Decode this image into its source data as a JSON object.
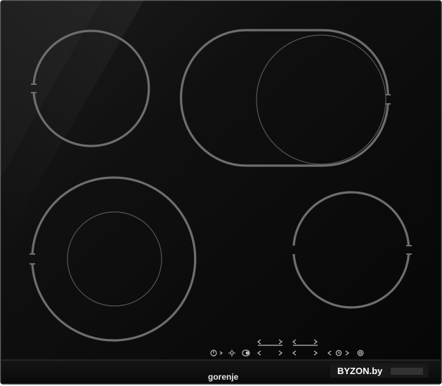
{
  "product": {
    "brand": "gorenje",
    "watermark": "BYZON.by"
  },
  "controls": {
    "lower_row": [
      "power-lock-icon",
      "chevron-right-icon",
      "sun-icon",
      "toggle-icon",
      "chevron-left-icon",
      "chevron-right-icon",
      "chevron-left-icon",
      "chevron-right-icon",
      "chevron-left-icon",
      "timer-icon",
      "chevron-right-icon",
      "target-icon"
    ],
    "upper_row": [
      "chevron-left-icon",
      "chevron-right-icon",
      "chevron-left-icon",
      "chevron-right-icon"
    ]
  },
  "zones": [
    {
      "name": "top-left",
      "rings": 1
    },
    {
      "name": "top-right-oval",
      "rings": 2
    },
    {
      "name": "bottom-left",
      "rings": 2
    },
    {
      "name": "bottom-right",
      "rings": 1
    }
  ],
  "colors": {
    "glass": "#0b0b0b",
    "frame": "#2a2a2a",
    "zone_ring": "#6e6e6e",
    "zone_inner": "#555555",
    "symbol": "#bdbdbd",
    "brand_text": "#e6e6e6",
    "watermark_bg": "#1b1b1b",
    "watermark_text": "#ffffff"
  }
}
